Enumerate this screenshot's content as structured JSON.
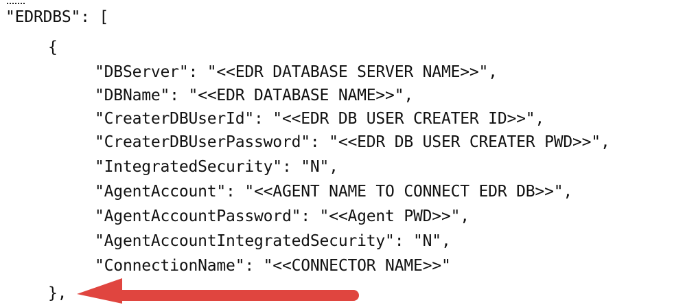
{
  "code": {
    "clipped_top_glyph": "--",
    "lines": [
      "\"EDRDBS\": [",
      "{",
      "\"DBServer\": \"<<EDR DATABASE SERVER NAME>>\",",
      "\"DBName\": \"<<EDR DATABASE NAME>>\",",
      "\"CreaterDBUserId\": \"<<EDR DB USER CREATER ID>>\",",
      "\"CreaterDBUserPassword\": \"<<EDR DB USER CREATER PWD>>\",",
      "\"IntegratedSecurity\": \"N\",",
      "\"AgentAccount\": \"<<AGENT NAME TO CONNECT EDR DB>>\",",
      "\"AgentAccountPassword\": \"<<Agent PWD>>\",",
      "\"AgentAccountIntegratedSecurity\": \"N\",",
      "\"ConnectionName\": \"<<CONNECTOR NAME>>\"",
      "},"
    ]
  },
  "annotation": {
    "arrow_icon": "left-arrow-icon",
    "arrow_color": "#e0453f"
  }
}
